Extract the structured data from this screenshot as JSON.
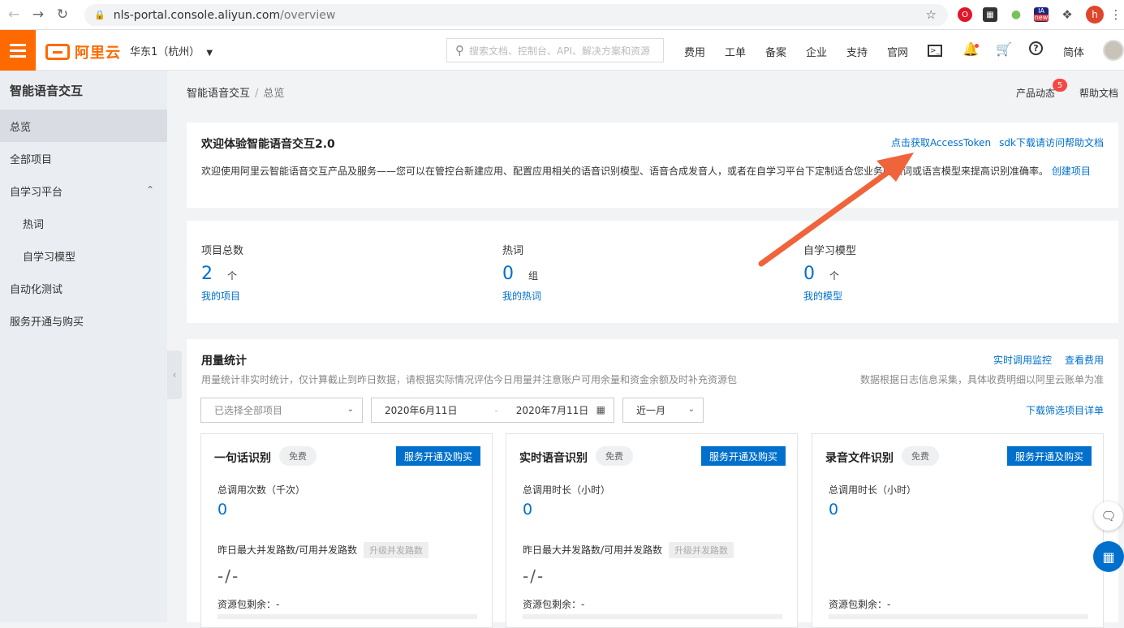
{
  "browser": {
    "url_host": "nls-portal.console.aliyun.com",
    "url_path": "/overview",
    "profile_initial": "h",
    "ext_new_label": "new"
  },
  "header": {
    "brand": "阿里云",
    "region": "华东1（杭州）",
    "search_placeholder": "搜索文档、控制台、API、解决方案和资源",
    "nav": [
      "费用",
      "工单",
      "备案",
      "企业",
      "支持",
      "官网"
    ],
    "lang": "简体"
  },
  "sidebar": {
    "title": "智能语音交互",
    "items": [
      "总览",
      "全部项目",
      "自学习平台",
      "热词",
      "自学习模型",
      "自动化测试",
      "服务开通与购买"
    ]
  },
  "breadcrumb": {
    "root": "智能语音交互",
    "sep": "/",
    "current": "总览"
  },
  "top_links": {
    "news": "产品动态",
    "news_count": "5",
    "help": "帮助文档"
  },
  "welcome": {
    "title": "欢迎体验智能语音交互2.0",
    "link_token": "点击获取AccessToken",
    "link_sdk": "sdk下载请访问帮助文档",
    "body": "欢迎使用阿里云智能语音交互产品及服务——您可以在管控台新建应用、配置应用相关的语音识别模型、语音合成发音人，或者在自学习平台下定制适合您业务的热词或语言模型来提高识别准确率。",
    "create_link": "创建项目"
  },
  "stats": [
    {
      "label": "项目总数",
      "value": "2",
      "unit": "个",
      "link": "我的项目"
    },
    {
      "label": "热词",
      "value": "0",
      "unit": "组",
      "link": "我的热词"
    },
    {
      "label": "自学习模型",
      "value": "0",
      "unit": "个",
      "link": "我的模型"
    }
  ],
  "usage": {
    "title": "用量统计",
    "desc": "用量统计非实时统计，仅计算截止到昨日数据，请根据实际情况评估今日用量并注意账户可用余量和资金余额及时补充资源包",
    "link_monitor": "实时调用监控",
    "link_fee": "查看费用",
    "rdesc": "数据根据日志信息采集，具体收费明细以阿里云账单为准",
    "project_select": "已选择全部项目",
    "date_start": "2020年6月11日",
    "date_sep": "-",
    "date_end": "2020年7月11日",
    "range_select": "近一月",
    "download": "下载筛选项目详单"
  },
  "products": [
    {
      "title": "一句话识别",
      "free": "免费",
      "buy": "服务开通及购买",
      "metric": "总调用次数（千次）",
      "value": "0",
      "concurrency": "昨日最大并发路数/可用并发路数",
      "upgrade": "升级并发路数",
      "dash": "-/-",
      "remain": "资源包剩余：-"
    },
    {
      "title": "实时语音识别",
      "free": "免费",
      "buy": "服务开通及购买",
      "metric": "总调用时长（小时）",
      "value": "0",
      "concurrency": "昨日最大并发路数/可用并发路数",
      "upgrade": "升级并发路数",
      "dash": "-/-",
      "remain": "资源包剩余：-"
    },
    {
      "title": "录音文件识别",
      "free": "免费",
      "buy": "服务开通及购买",
      "metric": "总调用时长（小时）",
      "value": "0",
      "remain": "资源包剩余：-"
    }
  ],
  "colors": {
    "brand": "#ff6a00",
    "link": "#0070cc",
    "arrow": "#f0643c"
  }
}
